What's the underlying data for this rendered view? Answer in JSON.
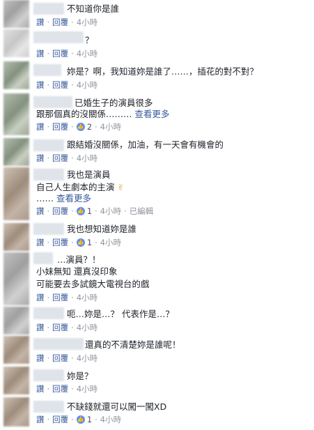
{
  "actions": {
    "like": "讚",
    "reply": "回覆",
    "sep": "·",
    "edited": "已編輯"
  },
  "comments": [
    {
      "lines": [
        "不知道你是誰"
      ],
      "time": "4小時"
    },
    {
      "lines": [
        "？"
      ],
      "time": "4小時"
    },
    {
      "lines": [
        "妳是？啊，我知道妳是誰了……，插花的對不對？"
      ],
      "time": "4小時"
    },
    {
      "lines": [
        "已婚生子的演員很多",
        "跟那個真的沒關係………"
      ],
      "see_more": "查看更多",
      "likes": "2",
      "time": "4小時"
    },
    {
      "lines": [
        "跟結婚沒關係，加油，有一天會有機會的"
      ],
      "time": "4小時"
    },
    {
      "lines": [
        "我也是演員",
        "自己人生劇本的主演",
        "……"
      ],
      "see_more": "查看更多",
      "emoji": "✌",
      "likes": "1",
      "time": "4小時"
    },
    {
      "lines": [
        "我也想知道妳是誰"
      ],
      "likes": "1",
      "time": "4小時"
    },
    {
      "lines": [
        "…演員？！",
        "小妹無知 還真沒印象",
        "可能要去多試鏡大電視台的戲"
      ],
      "time": "4小時"
    },
    {
      "lines": [
        "呃…妳是…？ 代表作是…？"
      ],
      "time": "4小時"
    },
    {
      "lines": [
        "還真的不清楚妳是誰呢！"
      ],
      "time": "4小時"
    },
    {
      "lines": [
        "妳是？"
      ],
      "time": "4小時"
    },
    {
      "lines": [
        "不缺錢就還可以闖一闖XD"
      ],
      "likes": "1",
      "time": "4小時"
    }
  ]
}
